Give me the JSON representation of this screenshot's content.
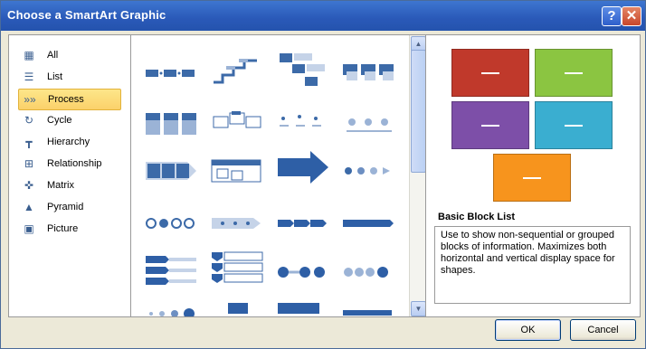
{
  "window": {
    "title": "Choose a SmartArt Graphic"
  },
  "title_buttons": {
    "help": "?",
    "close": "✕"
  },
  "categories": [
    {
      "label": "All",
      "icon": "all-icon",
      "glyph": "▦"
    },
    {
      "label": "List",
      "icon": "list-icon",
      "glyph": "☰"
    },
    {
      "label": "Process",
      "icon": "process-icon",
      "glyph": "»»"
    },
    {
      "label": "Cycle",
      "icon": "cycle-icon",
      "glyph": "↻"
    },
    {
      "label": "Hierarchy",
      "icon": "hierarchy-icon",
      "glyph": "┳"
    },
    {
      "label": "Relationship",
      "icon": "relationship-icon",
      "glyph": "⊞"
    },
    {
      "label": "Matrix",
      "icon": "matrix-icon",
      "glyph": "✜"
    },
    {
      "label": "Pyramid",
      "icon": "pyramid-icon",
      "glyph": "▲"
    },
    {
      "label": "Picture",
      "icon": "picture-icon",
      "glyph": "▣"
    }
  ],
  "selected_category": "Process",
  "gallery": {
    "layout_count": 24
  },
  "preview": {
    "title": "Basic Block List",
    "description": "Use to show non-sequential or grouped blocks of information. Maximizes both horizontal and vertical display space for shapes.",
    "colors": [
      "#c0392b",
      "#8bc541",
      "#7d4fa8",
      "#3aaed0",
      "#f7941d"
    ]
  },
  "buttons": {
    "ok": "OK",
    "cancel": "Cancel"
  },
  "colors": {
    "accent": "#2e5fa6",
    "thumb_light": "#c5d3e8",
    "selection": "#fbd16a"
  }
}
